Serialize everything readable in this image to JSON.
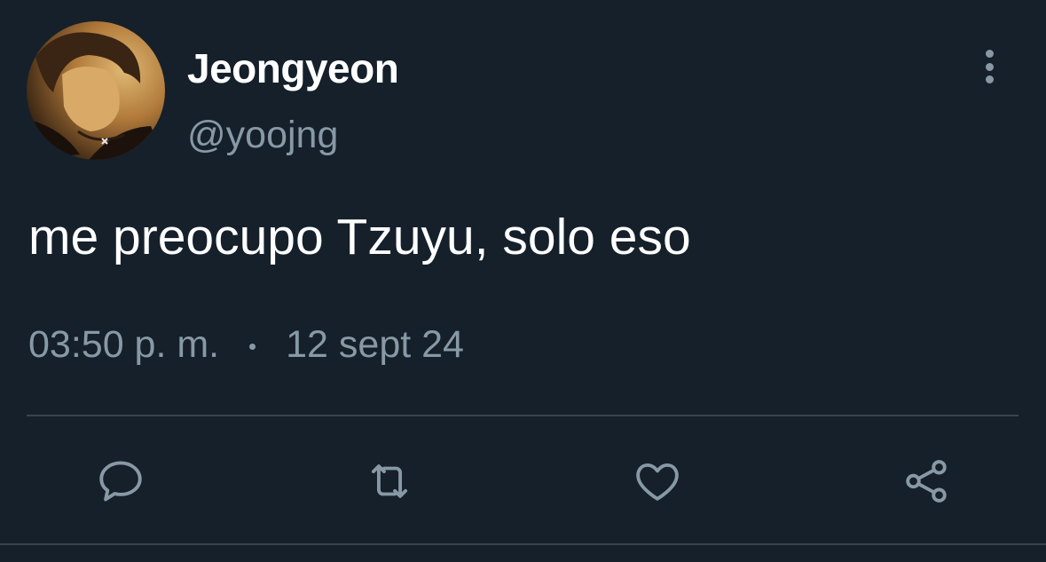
{
  "tweet": {
    "author": {
      "display_name": "Jeongyeon",
      "handle": "@yoojng",
      "avatar_icon": "profile-photo"
    },
    "text": "me preocupo Tzuyu, solo eso",
    "time": "03:50 p. m.",
    "date": "12 sept 24"
  },
  "actions": [
    {
      "name": "reply",
      "icon": "speech-bubble-icon"
    },
    {
      "name": "retweet",
      "icon": "retweet-arrows-icon"
    },
    {
      "name": "like",
      "icon": "heart-icon"
    },
    {
      "name": "share",
      "icon": "share-nodes-icon"
    }
  ],
  "colors": {
    "background": "#15202b",
    "primary_text": "#ffffff",
    "secondary_text": "#8899a6",
    "divider": "#38444d"
  }
}
